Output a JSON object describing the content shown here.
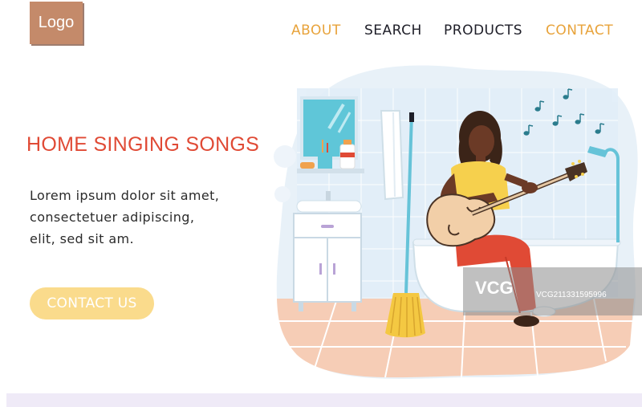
{
  "header": {
    "logo_label": "Logo",
    "nav": [
      "ABOUT",
      "SEARCH",
      "PRODUCTS",
      "CONTACT"
    ]
  },
  "hero": {
    "title": "HOME SINGING SONGS",
    "body_lines": [
      "Lorem ipsum dolor sit amet,",
      "consectetuer adipiscing,",
      "elit, sed sit am."
    ],
    "cta_label": "CONTACT US"
  },
  "illustration": {
    "subject": "woman playing guitar in bathroom",
    "icons": [
      "music-note-icon",
      "guitar-icon",
      "mop-icon",
      "towel-icon",
      "mirror-icon",
      "bathtub-icon",
      "shower-icon",
      "sink-cabinet-icon"
    ]
  },
  "watermark": {
    "logo_text": "VCG",
    "id_text": "VCG211331595996"
  },
  "colors": {
    "accent_orange": "#e8a33b",
    "title_red": "#e04a35",
    "logo_bg": "#c48a6a",
    "cta_bg": "#fadb8c",
    "nav_dark": "#1e1e28"
  }
}
